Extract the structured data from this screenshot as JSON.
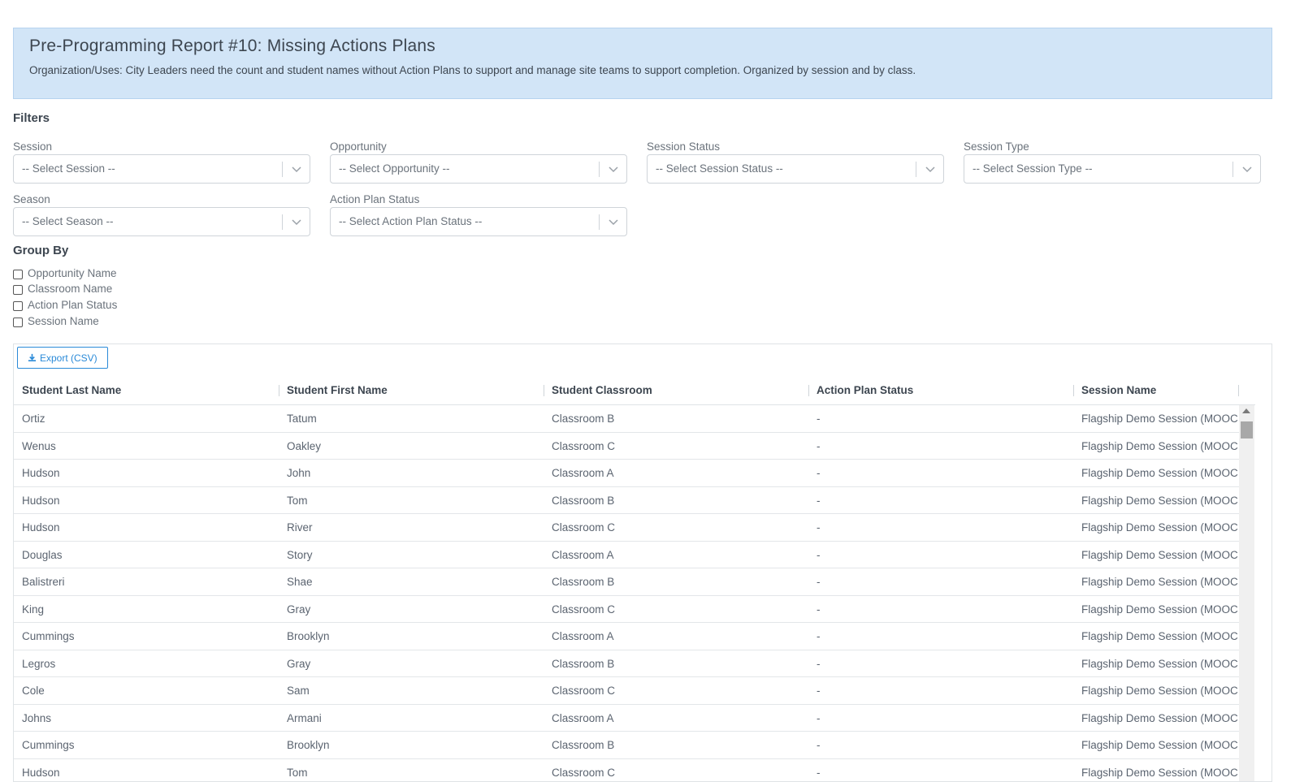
{
  "banner": {
    "title": "Pre-Programming Report #10: Missing Actions Plans",
    "description": "Organization/Uses: City Leaders need the count and student names without Action Plans to support and manage site teams to support completion. Organized by session and by class."
  },
  "filters": {
    "title": "Filters",
    "session": {
      "label": "Session",
      "value": "-- Select Session --"
    },
    "opportunity": {
      "label": "Opportunity",
      "value": "-- Select Opportunity --"
    },
    "session_status": {
      "label": "Session Status",
      "value": "-- Select Session Status --"
    },
    "session_type": {
      "label": "Session Type",
      "value": "-- Select Session Type --"
    },
    "season": {
      "label": "Season",
      "value": "-- Select Season --"
    },
    "action_plan_status": {
      "label": "Action Plan Status",
      "value": "-- Select Action Plan Status --"
    }
  },
  "group_by": {
    "title": "Group By",
    "options": [
      {
        "label": "Opportunity Name",
        "checked": false
      },
      {
        "label": "Classroom Name",
        "checked": false
      },
      {
        "label": "Action Plan Status",
        "checked": false
      },
      {
        "label": "Session Name",
        "checked": false
      }
    ]
  },
  "grid": {
    "export_label": "Export (CSV)",
    "columns": [
      "Student Last Name",
      "Student First Name",
      "Student Classroom",
      "Action Plan Status",
      "Session Name"
    ],
    "rows": [
      [
        "Ortiz",
        "Tatum",
        "Classroom B",
        "-",
        "Flagship Demo Session (MOOC"
      ],
      [
        "Wenus",
        "Oakley",
        "Classroom C",
        "-",
        "Flagship Demo Session (MOOC"
      ],
      [
        "Hudson",
        "John",
        "Classroom A",
        "-",
        "Flagship Demo Session (MOOC"
      ],
      [
        "Hudson",
        "Tom",
        "Classroom B",
        "-",
        "Flagship Demo Session (MOOC"
      ],
      [
        "Hudson",
        "River",
        "Classroom C",
        "-",
        "Flagship Demo Session (MOOC"
      ],
      [
        "Douglas",
        "Story",
        "Classroom A",
        "-",
        "Flagship Demo Session (MOOC"
      ],
      [
        "Balistreri",
        "Shae",
        "Classroom B",
        "-",
        "Flagship Demo Session (MOOC"
      ],
      [
        "King",
        "Gray",
        "Classroom C",
        "-",
        "Flagship Demo Session (MOOC"
      ],
      [
        "Cummings",
        "Brooklyn",
        "Classroom A",
        "-",
        "Flagship Demo Session (MOOC"
      ],
      [
        "Legros",
        "Gray",
        "Classroom B",
        "-",
        "Flagship Demo Session (MOOC"
      ],
      [
        "Cole",
        "Sam",
        "Classroom C",
        "-",
        "Flagship Demo Session (MOOC"
      ],
      [
        "Johns",
        "Armani",
        "Classroom A",
        "-",
        "Flagship Demo Session (MOOC"
      ],
      [
        "Cummings",
        "Brooklyn",
        "Classroom B",
        "-",
        "Flagship Demo Session (MOOC"
      ],
      [
        "Hudson",
        "Tom",
        "Classroom C",
        "-",
        "Flagship Demo Session (MOOC"
      ]
    ]
  }
}
